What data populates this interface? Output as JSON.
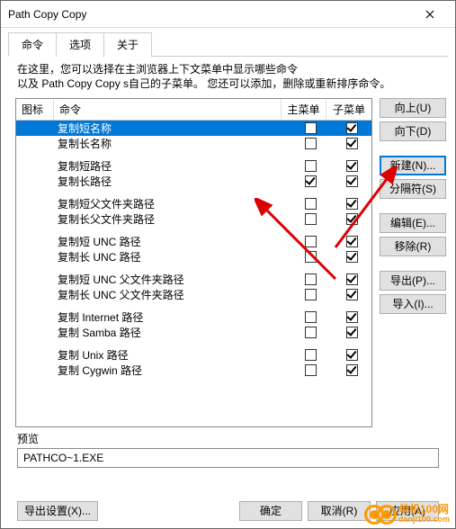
{
  "window": {
    "title": "Path Copy Copy"
  },
  "tabs": {
    "cmd": "命令",
    "opt": "选项",
    "about": "关于"
  },
  "desc": {
    "line1": "在这里，您可以选择在主浏览器上下文菜单中显示哪些命令",
    "line2": "以及 Path Copy Copy s自己的子菜单。 您还可以添加，删除或重新排序命令。"
  },
  "headers": {
    "icon": "图标",
    "cmd": "命令",
    "main": "主菜单",
    "sub": "子菜单"
  },
  "rows": [
    {
      "label": "复制短名称",
      "main": false,
      "sub": true,
      "sel": true
    },
    {
      "label": "复制长名称",
      "main": false,
      "sub": true
    },
    {
      "sep": true
    },
    {
      "label": "复制短路径",
      "main": false,
      "sub": true
    },
    {
      "label": "复制长路径",
      "main": true,
      "sub": true
    },
    {
      "sep": true
    },
    {
      "label": "复制短父文件夹路径",
      "main": false,
      "sub": true
    },
    {
      "label": "复制长父文件夹路径",
      "main": false,
      "sub": true
    },
    {
      "sep": true
    },
    {
      "label": "复制短 UNC 路径",
      "main": false,
      "sub": true
    },
    {
      "label": "复制长 UNC 路径",
      "main": false,
      "sub": true
    },
    {
      "sep": true
    },
    {
      "label": "复制短 UNC 父文件夹路径",
      "main": false,
      "sub": true
    },
    {
      "label": "复制长 UNC 父文件夹路径",
      "main": false,
      "sub": true
    },
    {
      "sep": true
    },
    {
      "label": "复制 Internet 路径",
      "main": false,
      "sub": true
    },
    {
      "label": "复制 Samba 路径",
      "main": false,
      "sub": true
    },
    {
      "sep": true
    },
    {
      "label": "复制 Unix 路径",
      "main": false,
      "sub": true
    },
    {
      "label": "复制 Cygwin 路径",
      "main": false,
      "sub": true
    }
  ],
  "sidebtns": {
    "up": "向上(U)",
    "down": "向下(D)",
    "new": "新建(N)...",
    "sep": "分隔符(S)",
    "edit": "编辑(E)...",
    "remove": "移除(R)",
    "export": "导出(P)...",
    "import": "导入(I)..."
  },
  "preview": {
    "label": "预览",
    "value": "PATHCO~1.EXE"
  },
  "footer": {
    "exportset": "导出设置(X)...",
    "ok": "确定",
    "cancel": "取消(R)",
    "apply": "应用(A)"
  },
  "watermark": {
    "text": "单机100网",
    "sub": "danji100.com"
  }
}
